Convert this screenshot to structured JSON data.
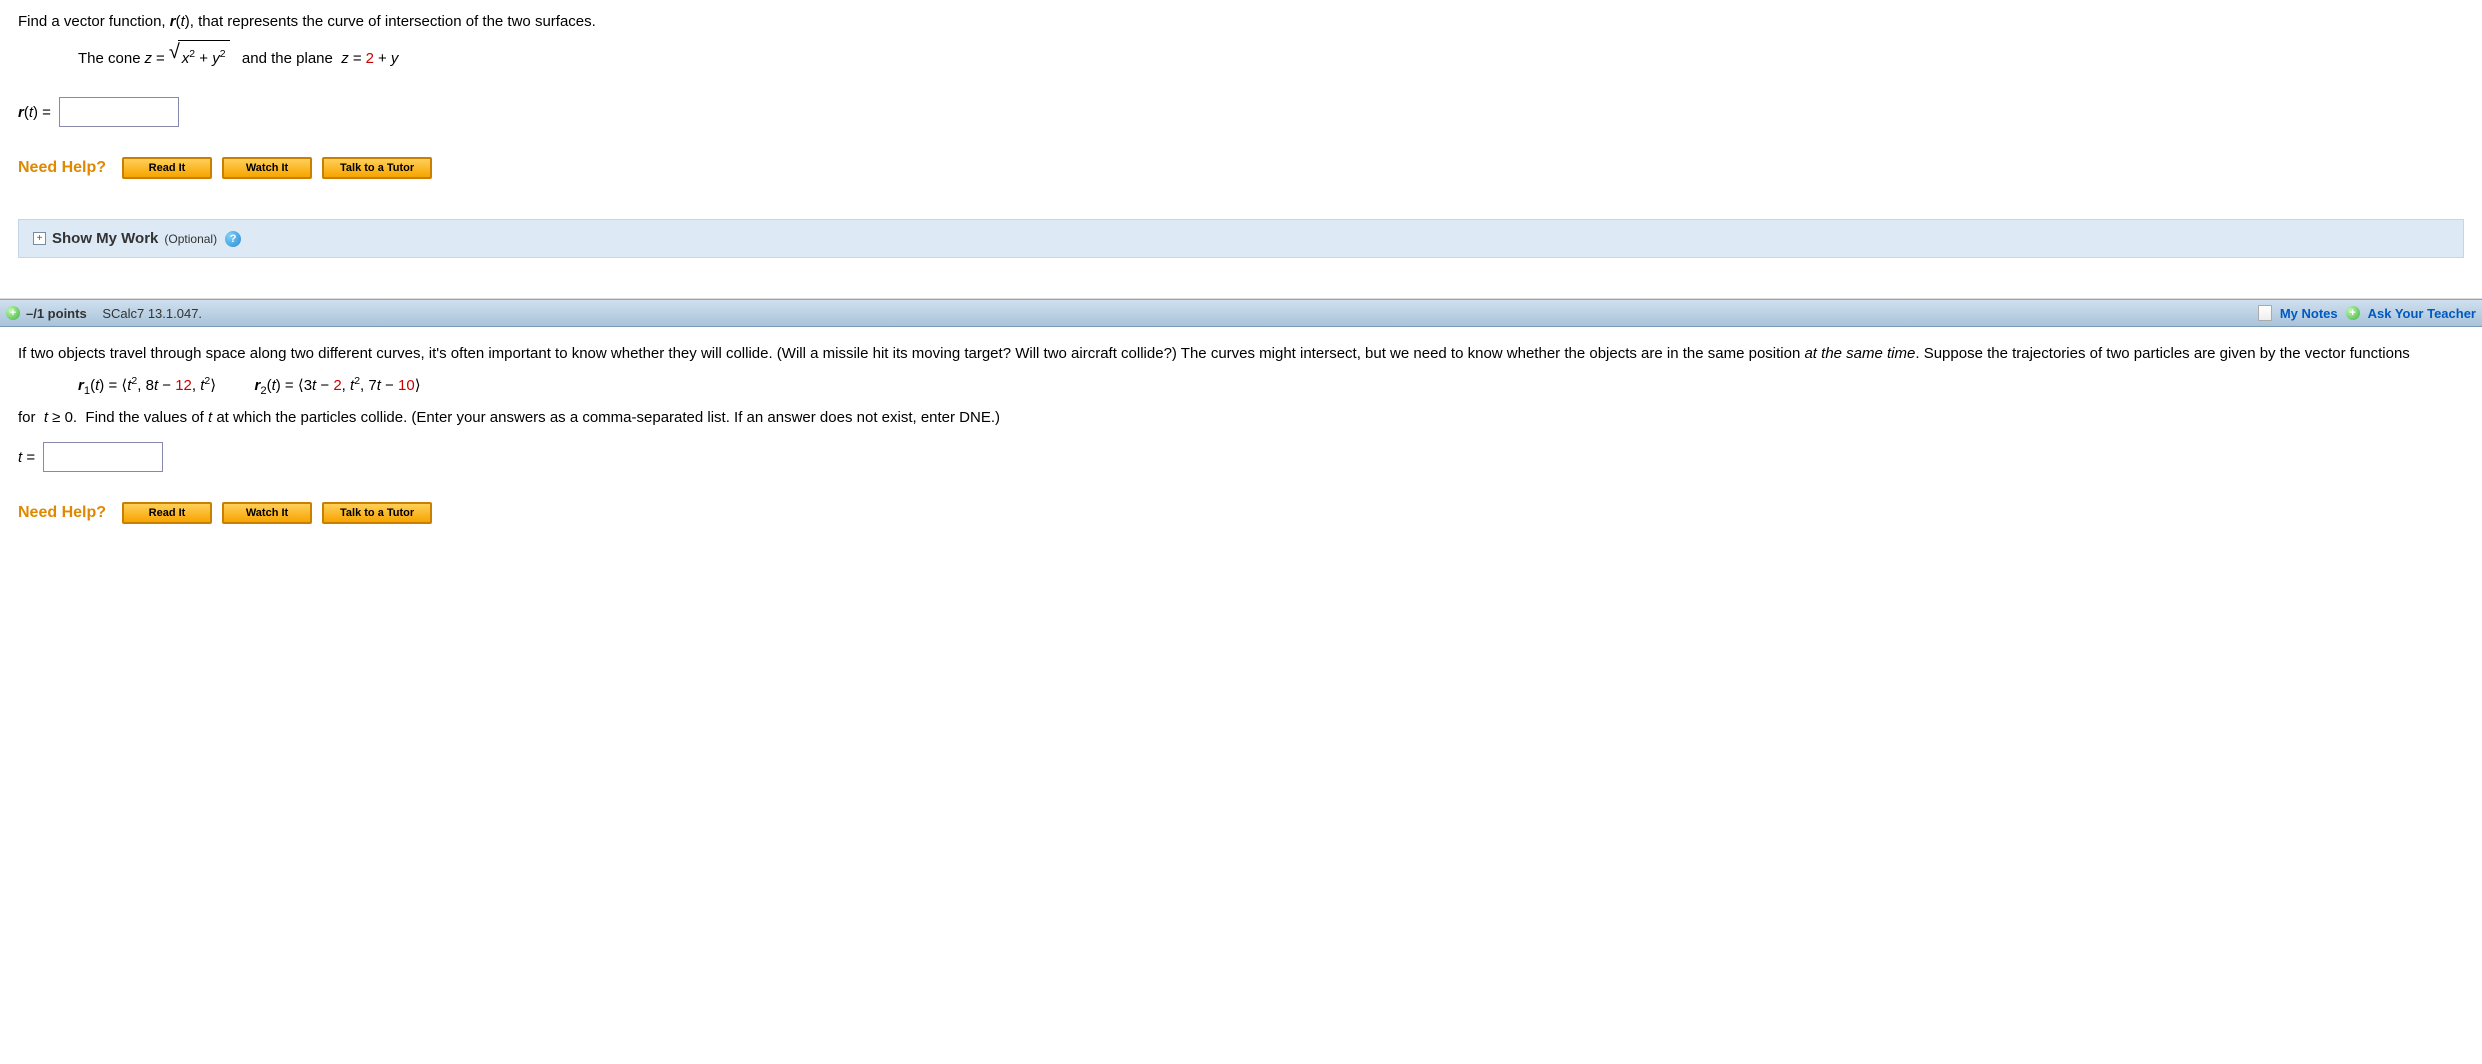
{
  "q1": {
    "prompt": "Find a vector function, r(t), that represents the curve of intersection of the two surfaces.",
    "cone_prefix": "The cone ",
    "cone_z": "z = ",
    "sqrt_body": "x² + y²",
    "plane_text": "  and the plane  z = ",
    "plane_rhs_a": "2",
    "plane_rhs_b": " + y",
    "answer_label": "r(t) =",
    "input_value": ""
  },
  "help": {
    "label": "Need Help?",
    "read": "Read It",
    "watch": "Watch It",
    "tutor": "Talk to a Tutor"
  },
  "show_work": {
    "title": "Show My Work",
    "optional": "(Optional)",
    "plus": "+",
    "q": "?"
  },
  "q2header": {
    "plus": "+",
    "points": "–/1 points",
    "qid": "SCalc7 13.1.047.",
    "mynotes": "My Notes",
    "ask": "Ask Your Teacher"
  },
  "q2": {
    "text_a": "If two objects travel through space along two different curves, it's often important to know whether they will collide. (Will a missile hit its moving target? Will two aircraft collide?) The curves might intersect, but we need to know whether the objects are in the same position ",
    "text_em": "at the same time",
    "text_b": ". Suppose the trajectories of two particles are given by the vector functions",
    "r1_label": "r",
    "r1_sub": "1",
    "r1_arg": "(t) = ",
    "r1_tuple_1": "t²",
    "r1_tuple_2a": ", 8t − ",
    "r1_tuple_2b": "12",
    "r1_tuple_3": ", t²",
    "r2_label": "r",
    "r2_sub": "2",
    "r2_arg": "(t) = ",
    "r2_tuple_1a": "3t − ",
    "r2_tuple_1b": "2",
    "r2_tuple_2": ", t²",
    "r2_tuple_3a": ", 7t − ",
    "r2_tuple_3b": "10",
    "for_text": "for  t ≥ 0.  Find the values of t at which the particles collide. (Enter your answers as a comma-separated list. If an answer does not exist, enter DNE.)",
    "answer_label": "t =",
    "input_value": ""
  }
}
